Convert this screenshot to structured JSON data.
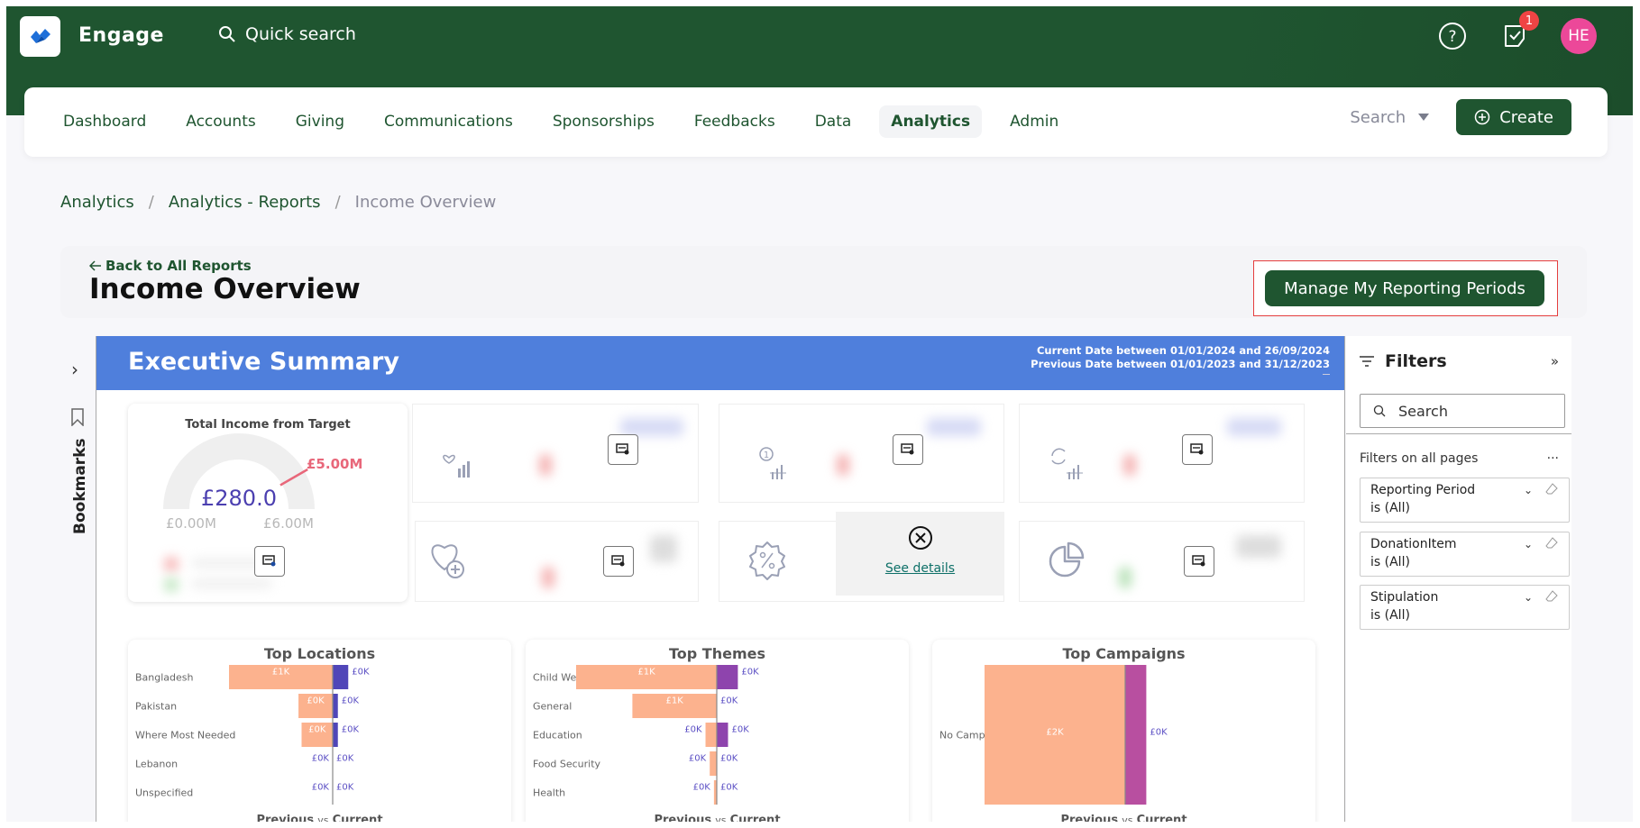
{
  "app": {
    "name": "Engage",
    "quick_search_placeholder": "Quick search",
    "notification_count": "1",
    "user_initials": "HE",
    "accent_color": "#1f5530",
    "avatar_color": "#ec4899"
  },
  "nav": {
    "items": [
      {
        "label": "Dashboard",
        "active": false
      },
      {
        "label": "Accounts",
        "active": false
      },
      {
        "label": "Giving",
        "active": false
      },
      {
        "label": "Communications",
        "active": false
      },
      {
        "label": "Sponsorships",
        "active": false
      },
      {
        "label": "Feedbacks",
        "active": false
      },
      {
        "label": "Data",
        "active": false
      },
      {
        "label": "Analytics",
        "active": true
      },
      {
        "label": "Admin",
        "active": false
      }
    ],
    "search_label": "Search",
    "create_label": "Create"
  },
  "breadcrumb": [
    "Analytics",
    "Analytics - Reports",
    "Income Overview"
  ],
  "page": {
    "back_label": "Back to All Reports",
    "title": "Income Overview",
    "manage_button": "Manage My Reporting Periods"
  },
  "bookmarks": {
    "label": "Bookmarks"
  },
  "report": {
    "title": "Executive Summary",
    "current_date_range": "Current Date between 01/01/2024 and 26/09/2024",
    "previous_date_range": "Previous Date between 01/01/2023 and 31/12/2023",
    "gauge": {
      "title": "Total Income from Target",
      "value_label": "£280.0",
      "target_label": "£5.00M",
      "min_label": "£0.00M",
      "max_label": "£6.00M",
      "value": 280.0,
      "target": 5000000,
      "min": 0,
      "max": 6000000
    },
    "kpi_cards": [
      {
        "icon": "heart-bars-icon"
      },
      {
        "icon": "one-count-bars-icon"
      },
      {
        "icon": "refresh-bars-icon"
      },
      {
        "icon": "heart-plus-icon"
      },
      {
        "icon": "percent-badge-icon",
        "error": true,
        "error_link": "See details"
      },
      {
        "icon": "pie-chart-icon"
      }
    ],
    "footer_label_previous": "Previous",
    "footer_label_vs": "vs",
    "footer_label_current": "Current"
  },
  "filters": {
    "title": "Filters",
    "search_placeholder": "Search",
    "section_label": "Filters on all pages",
    "more_label": "...",
    "items": [
      {
        "name": "Reporting Period",
        "value": "is (All)"
      },
      {
        "name": "DonationItem",
        "value": "is (All)"
      },
      {
        "name": "Stipulation",
        "value": "is (All)"
      }
    ]
  },
  "chart_data": [
    {
      "type": "bar",
      "title": "Top Locations",
      "orientation": "horizontal-diverging",
      "categories": [
        "Bangladesh",
        "Pakistan",
        "Where Most Needed",
        "Lebanon",
        "Unspecified"
      ],
      "series": [
        {
          "name": "Previous",
          "color": "#fcb28e",
          "values": [
            1.0,
            0.33,
            0.3,
            0.0,
            0.0
          ],
          "labels": [
            "£1K",
            "£0K",
            "£0K",
            "£0K",
            "£0K"
          ]
        },
        {
          "name": "Current",
          "color": "#5046b8",
          "values": [
            0.15,
            0.05,
            0.05,
            0.0,
            0.0
          ],
          "labels": [
            "£0K",
            "£0K",
            "£0K",
            "£0K",
            "£0K"
          ]
        }
      ],
      "xlabel": "Previous vs Current"
    },
    {
      "type": "bar",
      "title": "Top Themes",
      "orientation": "horizontal-diverging",
      "categories": [
        "Child Welfare",
        "General",
        "Education",
        "Food Security",
        "Health"
      ],
      "series": [
        {
          "name": "Previous",
          "color": "#fcb28e",
          "values": [
            1.0,
            0.6,
            0.08,
            0.05,
            0.02
          ],
          "labels": [
            "£1K",
            "£1K",
            "£0K",
            "£0K",
            "£0K"
          ]
        },
        {
          "name": "Current",
          "color": "#8e44ad",
          "values": [
            0.15,
            0.0,
            0.08,
            0.0,
            0.0
          ],
          "labels": [
            "£0K",
            "£0K",
            "£0K",
            "£0K",
            "£0K"
          ]
        }
      ],
      "xlabel": "Previous vs Current"
    },
    {
      "type": "bar",
      "title": "Top Campaigns",
      "orientation": "horizontal-diverging",
      "categories": [
        "No Campaign"
      ],
      "series": [
        {
          "name": "Previous",
          "color": "#fcb28e",
          "values": [
            2.0
          ],
          "labels": [
            "£2K"
          ]
        },
        {
          "name": "Current",
          "color": "#b84fa0",
          "values": [
            0.3
          ],
          "labels": [
            "£0K"
          ]
        }
      ],
      "xlabel": "Previous vs Current"
    }
  ]
}
